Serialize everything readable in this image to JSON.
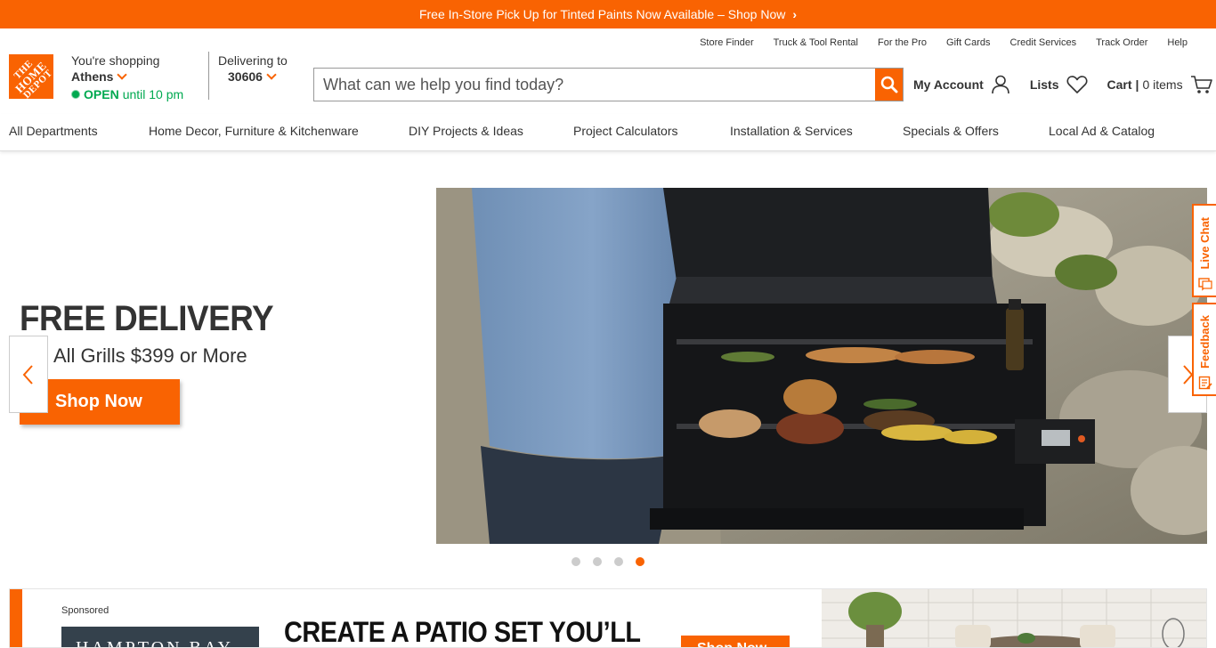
{
  "promo": {
    "text": "Free In-Store Pick Up for Tinted Paints Now Available – Shop Now",
    "chevron_icon": "chevron-right-icon"
  },
  "logo": {
    "text_lines": [
      "THE",
      "HOME",
      "DEPOT"
    ],
    "brand_color": "#f96302"
  },
  "store": {
    "label": "You're shopping",
    "city": "Athens",
    "status": "OPEN",
    "hours": "until 10 pm",
    "status_color": "#00a950"
  },
  "delivery": {
    "label": "Delivering to",
    "zip": "30606"
  },
  "utility_links": [
    "Store Finder",
    "Truck & Tool Rental",
    "For the Pro",
    "Gift Cards",
    "Credit Services",
    "Track Order",
    "Help"
  ],
  "search": {
    "placeholder": "What can we help you find today?",
    "value": ""
  },
  "actions": {
    "account": "My Account",
    "lists": "Lists",
    "cart": "Cart",
    "cart_sep": "|",
    "cart_count": "0 items"
  },
  "nav": [
    "All Departments",
    "Home Decor, Furniture & Kitchenware",
    "DIY Projects & Ideas",
    "Project Calculators",
    "Installation & Services",
    "Specials & Offers",
    "Local Ad & Catalog"
  ],
  "hero": {
    "title": "FREE DELIVERY",
    "subtitle": "All Grills $399 or More",
    "cta": "Shop Now",
    "slides": 4,
    "active_slide": 4
  },
  "side_tabs": {
    "live_chat": "Live Chat",
    "feedback": "Feedback"
  },
  "ad": {
    "sponsored": "Sponsored",
    "brand": "HAMPTON BAY",
    "headline": "CREATE A PATIO SET YOU’LL",
    "cta": "Shop Now"
  }
}
